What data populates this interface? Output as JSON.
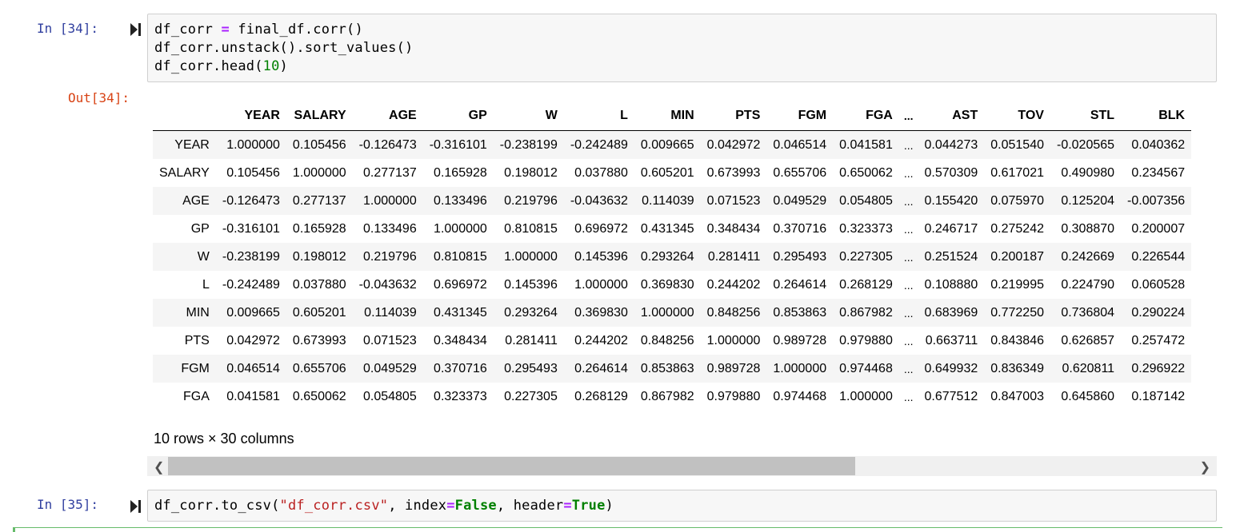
{
  "cells": {
    "in34": {
      "prompt": "In [34]:",
      "lines": [
        {
          "a": "df_corr ",
          "op": "=",
          "b": " final_df.corr()"
        },
        {
          "a": "df_corr.unstack().sort_values()"
        },
        {
          "a": "df_corr.head(",
          "num": "10",
          "b": ")"
        }
      ]
    },
    "out34": {
      "prompt": "Out[34]:"
    },
    "in35": {
      "prompt": "In [35]:",
      "code": {
        "p1": "df_corr.to_csv(",
        "str": "\"df_corr.csv\"",
        "p2": ", index",
        "op1": "=",
        "kw1": "False",
        "p3": ", header",
        "op2": "=",
        "kw2": "True",
        "p4": ")"
      }
    }
  },
  "dataframe": {
    "columns": [
      "YEAR",
      "SALARY",
      "AGE",
      "GP",
      "W",
      "L",
      "MIN",
      "PTS",
      "FGM",
      "FGA",
      "...",
      "AST",
      "TOV",
      "STL",
      "BLK"
    ],
    "rows": [
      {
        "index": "YEAR",
        "values": [
          "1.000000",
          "0.105456",
          "-0.126473",
          "-0.316101",
          "-0.238199",
          "-0.242489",
          "0.009665",
          "0.042972",
          "0.046514",
          "0.041581",
          "...",
          "0.044273",
          "0.051540",
          "-0.020565",
          "0.040362"
        ]
      },
      {
        "index": "SALARY",
        "values": [
          "0.105456",
          "1.000000",
          "0.277137",
          "0.165928",
          "0.198012",
          "0.037880",
          "0.605201",
          "0.673993",
          "0.655706",
          "0.650062",
          "...",
          "0.570309",
          "0.617021",
          "0.490980",
          "0.234567"
        ]
      },
      {
        "index": "AGE",
        "values": [
          "-0.126473",
          "0.277137",
          "1.000000",
          "0.133496",
          "0.219796",
          "-0.043632",
          "0.114039",
          "0.071523",
          "0.049529",
          "0.054805",
          "...",
          "0.155420",
          "0.075970",
          "0.125204",
          "-0.007356"
        ]
      },
      {
        "index": "GP",
        "values": [
          "-0.316101",
          "0.165928",
          "0.133496",
          "1.000000",
          "0.810815",
          "0.696972",
          "0.431345",
          "0.348434",
          "0.370716",
          "0.323373",
          "...",
          "0.246717",
          "0.275242",
          "0.308870",
          "0.200007"
        ]
      },
      {
        "index": "W",
        "values": [
          "-0.238199",
          "0.198012",
          "0.219796",
          "0.810815",
          "1.000000",
          "0.145396",
          "0.293264",
          "0.281411",
          "0.295493",
          "0.227305",
          "...",
          "0.251524",
          "0.200187",
          "0.242669",
          "0.226544"
        ]
      },
      {
        "index": "L",
        "values": [
          "-0.242489",
          "0.037880",
          "-0.043632",
          "0.696972",
          "0.145396",
          "1.000000",
          "0.369830",
          "0.244202",
          "0.264614",
          "0.268129",
          "...",
          "0.108880",
          "0.219995",
          "0.224790",
          "0.060528"
        ]
      },
      {
        "index": "MIN",
        "values": [
          "0.009665",
          "0.605201",
          "0.114039",
          "0.431345",
          "0.293264",
          "0.369830",
          "1.000000",
          "0.848256",
          "0.853863",
          "0.867982",
          "...",
          "0.683969",
          "0.772250",
          "0.736804",
          "0.290224"
        ]
      },
      {
        "index": "PTS",
        "values": [
          "0.042972",
          "0.673993",
          "0.071523",
          "0.348434",
          "0.281411",
          "0.244202",
          "0.848256",
          "1.000000",
          "0.989728",
          "0.979880",
          "...",
          "0.663711",
          "0.843846",
          "0.626857",
          "0.257472"
        ]
      },
      {
        "index": "FGM",
        "values": [
          "0.046514",
          "0.655706",
          "0.049529",
          "0.370716",
          "0.295493",
          "0.264614",
          "0.853863",
          "0.989728",
          "1.000000",
          "0.974468",
          "...",
          "0.649932",
          "0.836349",
          "0.620811",
          "0.296922"
        ]
      },
      {
        "index": "FGA",
        "values": [
          "0.041581",
          "0.650062",
          "0.054805",
          "0.323373",
          "0.227305",
          "0.268129",
          "0.867982",
          "0.979880",
          "0.974468",
          "1.000000",
          "...",
          "0.677512",
          "0.847003",
          "0.645860",
          "0.187142"
        ]
      }
    ],
    "shape_text": "10 rows × 30 columns"
  },
  "scrollbar": {
    "left_arrow": "❮",
    "right_arrow": "❯"
  },
  "icons": {
    "run": "run-cell-icon"
  },
  "colors": {
    "prompt_in": "#303F9F",
    "prompt_out": "#D84315",
    "operator": "#AA22FF",
    "number": "#008000",
    "string": "#BA2121",
    "keyword": "#008000",
    "cell_border_active": "#66bb6a"
  }
}
